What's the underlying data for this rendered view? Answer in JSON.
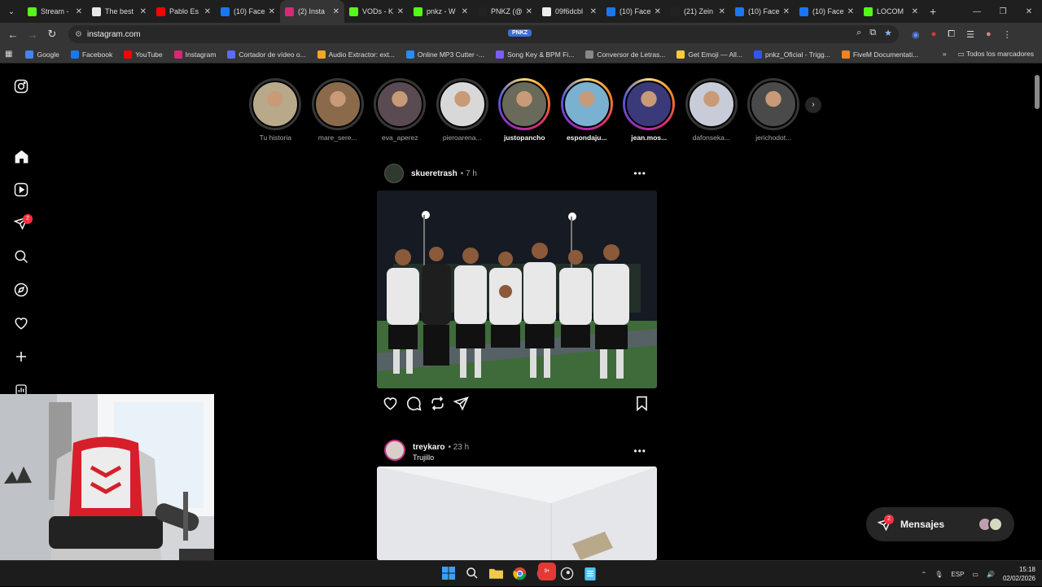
{
  "browser": {
    "tabs": [
      {
        "title": "Stream -",
        "color": "#53fc18",
        "active": false
      },
      {
        "title": "The best",
        "color": "#e8e8e8",
        "active": false
      },
      {
        "title": "Pablo Es",
        "color": "#ff0000",
        "active": false
      },
      {
        "title": "(10) Face",
        "color": "#1877f2",
        "active": false
      },
      {
        "title": "(2) Insta",
        "color": "#d62976",
        "active": true
      },
      {
        "title": "VODs - K",
        "color": "#53fc18",
        "active": false
      },
      {
        "title": "pnkz - W",
        "color": "#53fc18",
        "active": false
      },
      {
        "title": "PNKZ (@",
        "color": "#222222",
        "active": false
      },
      {
        "title": "09f6dcbl",
        "color": "#eeeeee",
        "active": false
      },
      {
        "title": "(10) Face",
        "color": "#1877f2",
        "active": false
      },
      {
        "title": "(21) Zein",
        "color": "#222222",
        "active": false
      },
      {
        "title": "(10) Face",
        "color": "#1877f2",
        "active": false
      },
      {
        "title": "(10) Face",
        "color": "#1877f2",
        "active": false
      },
      {
        "title": "LOCOM",
        "color": "#53fc18",
        "active": false
      }
    ],
    "url": "instagram.com",
    "url_badge": "PNKZ",
    "bookmarks": [
      {
        "label": "Google",
        "color": "#4285f4"
      },
      {
        "label": "Facebook",
        "color": "#1877f2"
      },
      {
        "label": "YouTube",
        "color": "#ff0000"
      },
      {
        "label": "Instagram",
        "color": "#d62976"
      },
      {
        "label": "Cortador de vídeo o...",
        "color": "#5b6cff"
      },
      {
        "label": "Audio Extractor: ext...",
        "color": "#f5a623"
      },
      {
        "label": "Online MP3 Cutter -...",
        "color": "#2a8bf2"
      },
      {
        "label": "Song Key & BPM Fi...",
        "color": "#7a5cff"
      },
      {
        "label": "Conversor de Letras...",
        "color": "#888888"
      },
      {
        "label": "Get Emoji — All...",
        "color": "#ffcc33"
      },
      {
        "label": "pnkz_Oficial - Trigg...",
        "color": "#3355ee"
      },
      {
        "label": "FiveM Documentati...",
        "color": "#f58220"
      }
    ],
    "bookmarks_folder": "Todos los marcadores"
  },
  "sidebar": {
    "notifications_badge": "2"
  },
  "stories": [
    {
      "name": "Tu historia",
      "seen": true,
      "color": "#b8a98a"
    },
    {
      "name": "mare_sere...",
      "seen": true,
      "color": "#8a6a4a"
    },
    {
      "name": "eva_aperez",
      "seen": true,
      "color": "#5a4a52"
    },
    {
      "name": "pieroarena...",
      "seen": true,
      "color": "#d8d8d8"
    },
    {
      "name": "justopancho",
      "seen": false,
      "color": "#6a6a5a"
    },
    {
      "name": "espondaju...",
      "seen": false,
      "color": "#7ab0d0"
    },
    {
      "name": "jean.mos...",
      "seen": false,
      "color": "#3a3a7a"
    },
    {
      "name": "dafonseka...",
      "seen": true,
      "color": "#c8ccd8"
    },
    {
      "name": "jerichodot...",
      "seen": true,
      "color": "#4a4a4a"
    }
  ],
  "posts": [
    {
      "username": "skueretrash",
      "time": "• 7 h",
      "location": ""
    },
    {
      "username": "treykaro",
      "time": "• 23 h",
      "location": "Trujillo"
    }
  ],
  "messages": {
    "label": "Mensajes",
    "badge": "2"
  },
  "taskbar": {
    "language": "ESP",
    "time": "15:18",
    "date": "02/02/2026",
    "discord_badge": "9+"
  }
}
